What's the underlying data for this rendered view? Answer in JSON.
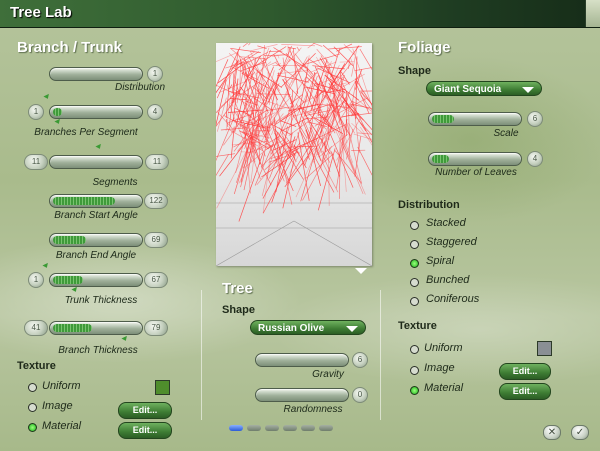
{
  "window": {
    "title": "Tree Lab"
  },
  "branch": {
    "heading": "Branch / Trunk",
    "sliders": [
      {
        "caption": "Distribution",
        "value_label": "1",
        "value": 0.0
      },
      {
        "caption": "Branches Per Segment",
        "min_label": "1",
        "value_label": "4",
        "value": 0.1
      },
      {
        "caption": "Segments",
        "min_label": "11",
        "value_label": "11",
        "value": 0.0
      },
      {
        "caption": "Branch Start Angle",
        "value_label": "122",
        "value": 0.72
      },
      {
        "caption": "Branch End Angle",
        "value_label": "69",
        "value": 0.38
      },
      {
        "caption": "Trunk Thickness",
        "min_label": "1",
        "value_label": "67",
        "value": 0.35
      },
      {
        "caption": "Branch Thickness",
        "min_label": "41",
        "value_label": "79",
        "value": 0.45
      }
    ],
    "texture": {
      "label": "Texture",
      "options": [
        {
          "label": "Uniform",
          "selected": false
        },
        {
          "label": "Image",
          "selected": false
        },
        {
          "label": "Material",
          "selected": true
        }
      ],
      "edit_label": "Edit...",
      "uniform_color": "#4f8d2c"
    }
  },
  "tree": {
    "heading": "Tree",
    "shape_label": "Shape",
    "shape_value": "Russian Olive",
    "sliders": [
      {
        "caption": "Gravity",
        "value_label": "6",
        "value": 0.0
      },
      {
        "caption": "Randomness",
        "value_label": "0",
        "value": 0.0
      }
    ]
  },
  "foliage": {
    "heading": "Foliage",
    "shape_label": "Shape",
    "shape_value": "Giant Sequoia",
    "sliders": [
      {
        "caption": "Scale",
        "value_label": "6",
        "value": 0.25
      },
      {
        "caption": "Number of Leaves",
        "value_label": "4",
        "value": 0.2
      }
    ],
    "distribution": {
      "label": "Distribution",
      "options": [
        {
          "label": "Stacked",
          "selected": false
        },
        {
          "label": "Staggered",
          "selected": false
        },
        {
          "label": "Spiral",
          "selected": true
        },
        {
          "label": "Bunched",
          "selected": false
        },
        {
          "label": "Coniferous",
          "selected": false
        }
      ]
    },
    "texture": {
      "label": "Texture",
      "options": [
        {
          "label": "Uniform",
          "selected": false
        },
        {
          "label": "Image",
          "selected": false
        },
        {
          "label": "Material",
          "selected": true
        }
      ],
      "edit_label": "Edit...",
      "uniform_color": "#8a8f94"
    }
  },
  "preview": {
    "branch_color": "#ff3b3b"
  },
  "footer": {
    "page_count": 6,
    "active_page": 0,
    "cancel_icon": "close-icon",
    "ok_icon": "check-icon"
  }
}
